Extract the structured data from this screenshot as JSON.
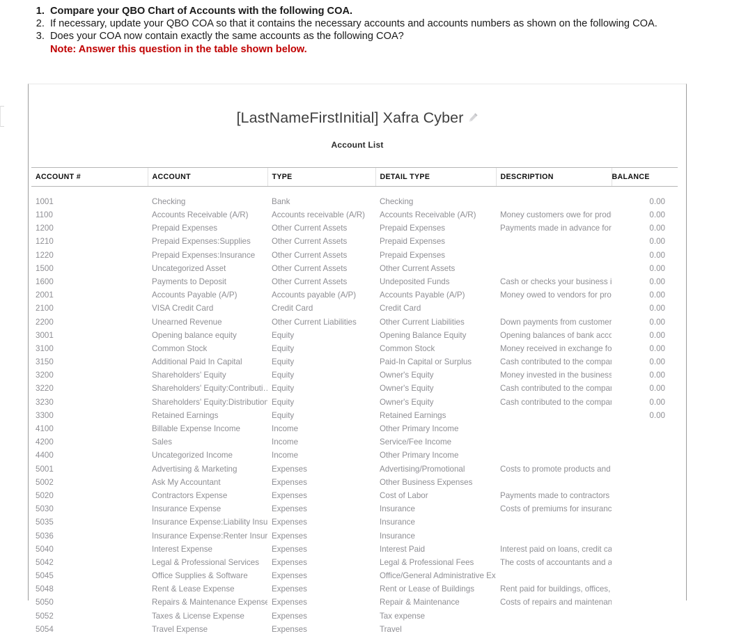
{
  "instructions": {
    "steps": [
      "Compare your QBO Chart of Accounts with the following COA.",
      "If necessary, update your QBO COA so that it contains the necessary accounts and accounts numbers as shown on the following COA.",
      "Does your COA now contain exactly the same accounts as the following COA?"
    ],
    "note": "Note: Answer this question in the table shown below."
  },
  "document": {
    "title": "[LastNameFirstInitial] Xafra Cyber",
    "subtitle": "Account List",
    "edit_icon": "pencil-icon"
  },
  "table": {
    "columns": [
      "ACCOUNT #",
      "ACCOUNT",
      "TYPE",
      "DETAIL TYPE",
      "DESCRIPTION",
      "BALANCE"
    ],
    "rows": [
      [
        "1001",
        "Checking",
        "Bank",
        "Checking",
        "",
        "0.00"
      ],
      [
        "1100",
        "Accounts Receivable (A/R)",
        "Accounts receivable (A/R)",
        "Accounts Receivable (A/R)",
        "Money customers owe for produ…",
        "0.00"
      ],
      [
        "1200",
        "Prepaid Expenses",
        "Other Current Assets",
        "Prepaid Expenses",
        "Payments made in advance for p…",
        "0.00"
      ],
      [
        "1210",
        "Prepaid Expenses:Supplies",
        "Other Current Assets",
        "Prepaid Expenses",
        "",
        "0.00"
      ],
      [
        "1220",
        "Prepaid Expenses:Insurance",
        "Other Current Assets",
        "Prepaid Expenses",
        "",
        "0.00"
      ],
      [
        "1500",
        "Uncategorized Asset",
        "Other Current Assets",
        "Other Current Assets",
        "",
        "0.00"
      ],
      [
        "1600",
        "Payments to Deposit",
        "Other Current Assets",
        "Undeposited Funds",
        "Cash or checks your business is r…",
        "0.00"
      ],
      [
        "2001",
        "Accounts Payable (A/P)",
        "Accounts payable (A/P)",
        "Accounts Payable (A/P)",
        "Money owed to vendors for pro…",
        "0.00"
      ],
      [
        "2100",
        "VISA Credit Card",
        "Credit Card",
        "Credit Card",
        "",
        "0.00"
      ],
      [
        "2200",
        "Unearned Revenue",
        "Other Current Liabilities",
        "Other Current Liabilities",
        "Down payments from customers…",
        "0.00"
      ],
      [
        "3001",
        "Opening balance equity",
        "Equity",
        "Opening Balance Equity",
        "Opening balances of bank acco…",
        "0.00"
      ],
      [
        "3100",
        "Common Stock",
        "Equity",
        "Common Stock",
        "Money received in exchange for …",
        "0.00"
      ],
      [
        "3150",
        "Additional Paid In Capital",
        "Equity",
        "Paid-In Capital or Surplus",
        "Cash contributed to the compan…",
        "0.00"
      ],
      [
        "3200",
        "Shareholders' Equity",
        "Equity",
        "Owner's Equity",
        "Money invested in the business …",
        "0.00"
      ],
      [
        "3220",
        "Shareholders' Equity:Contributi…",
        "Equity",
        "Owner's Equity",
        "Cash contributed to the compan…",
        "0.00"
      ],
      [
        "3230",
        "Shareholders' Equity:Distributions",
        "Equity",
        "Owner's Equity",
        "Cash contributed to the compan…",
        "0.00"
      ],
      [
        "3300",
        "Retained Earnings",
        "Equity",
        "Retained Earnings",
        "",
        "0.00"
      ],
      [
        "4100",
        "Billable Expense Income",
        "Income",
        "Other Primary Income",
        "",
        ""
      ],
      [
        "4200",
        "Sales",
        "Income",
        "Service/Fee Income",
        "",
        ""
      ],
      [
        "4400",
        "Uncategorized Income",
        "Income",
        "Other Primary Income",
        "",
        ""
      ],
      [
        "5001",
        "Advertising & Marketing",
        "Expenses",
        "Advertising/Promotional",
        "Costs to promote products and …",
        ""
      ],
      [
        "5002",
        "Ask My Accountant",
        "Expenses",
        "Other Business Expenses",
        "",
        ""
      ],
      [
        "5020",
        "Contractors Expense",
        "Expenses",
        "Cost of Labor",
        "Payments made to contractors o…",
        ""
      ],
      [
        "5030",
        "Insurance Expense",
        "Expenses",
        "Insurance",
        "Costs of premiums for insurance",
        ""
      ],
      [
        "5035",
        "Insurance Expense:Liability Insur…",
        "Expenses",
        "Insurance",
        "",
        ""
      ],
      [
        "5036",
        "Insurance Expense:Renter Insura…",
        "Expenses",
        "Insurance",
        "",
        ""
      ],
      [
        "5040",
        "Interest Expense",
        "Expenses",
        "Interest Paid",
        "Interest paid on loans, credit car…",
        ""
      ],
      [
        "5042",
        "Legal & Professional Services",
        "Expenses",
        "Legal & Professional Fees",
        "The costs of accountants and att…",
        ""
      ],
      [
        "5045",
        "Office Supplies & Software",
        "Expenses",
        "Office/General Administrative Ex…",
        "",
        ""
      ],
      [
        "5048",
        "Rent & Lease Expense",
        "Expenses",
        "Rent or Lease of Buildings",
        "Rent paid for buildings, offices, l…",
        ""
      ],
      [
        "5050",
        "Repairs & Maintenance Expense",
        "Expenses",
        "Repair & Maintenance",
        "Costs of repairs and maintenanc…",
        ""
      ],
      [
        "5052",
        "Taxes & License Expense",
        "Expenses",
        "Tax expense",
        "",
        ""
      ],
      [
        "5054",
        "Travel Expense",
        "Expenses",
        "Travel",
        "",
        ""
      ]
    ]
  },
  "colors": {
    "note_red": "#c00000",
    "body_text": "#1a1a1a",
    "table_text": "#8f8f94",
    "header_text": "#0f0f0f",
    "page_border": "#9c9c9c"
  }
}
